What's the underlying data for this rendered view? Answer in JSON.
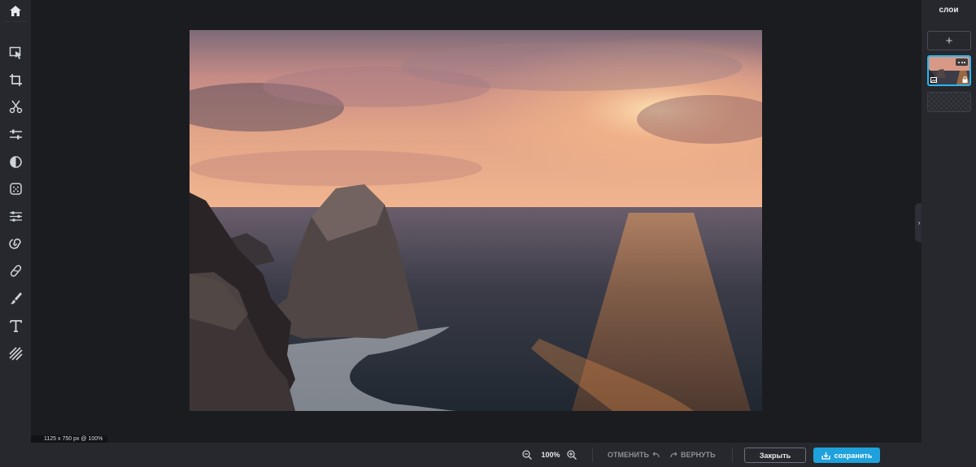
{
  "toolbar": {
    "items": [
      {
        "name": "home-icon"
      },
      {
        "name": "select-tool-icon"
      },
      {
        "name": "crop-icon"
      },
      {
        "name": "cut-icon"
      },
      {
        "name": "adjust-icon"
      },
      {
        "name": "contrast-icon"
      },
      {
        "name": "texture-icon"
      },
      {
        "name": "filters-icon"
      },
      {
        "name": "distort-icon"
      },
      {
        "name": "heal-icon"
      },
      {
        "name": "brush-icon"
      },
      {
        "name": "text-icon"
      },
      {
        "name": "pattern-icon"
      }
    ]
  },
  "canvas": {
    "image_description": "sunset over the sea with rocks",
    "dimensions": "1125 x 750 px @ 100%"
  },
  "layers": {
    "title": "слои",
    "add_label": "+"
  },
  "bottombar": {
    "zoom": "100%",
    "undo_label": "ОТМЕНИТЬ",
    "redo_label": "ВЕРНУТЬ",
    "close_label": "Закрыть",
    "save_label": "сохранить"
  },
  "colors": {
    "accent": "#1ea1dc",
    "panel": "#26282d",
    "workspace": "#1b1c20"
  }
}
